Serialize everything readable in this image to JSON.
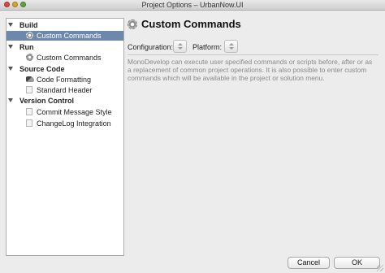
{
  "window": {
    "title": "Project Options – UrbanNow.UI"
  },
  "sidebar": {
    "groups": [
      {
        "label": "Build",
        "items": [
          {
            "label": "Custom Commands",
            "icon": "gear-icon",
            "selected": true
          }
        ]
      },
      {
        "label": "Run",
        "items": [
          {
            "label": "Custom Commands",
            "icon": "gear-icon",
            "selected": false
          }
        ]
      },
      {
        "label": "Source Code",
        "items": [
          {
            "label": "Code Formatting",
            "icon": "brush-icon",
            "selected": false
          },
          {
            "label": "Standard Header",
            "icon": "document-icon",
            "selected": false
          }
        ]
      },
      {
        "label": "Version Control",
        "items": [
          {
            "label": "Commit Message Style",
            "icon": "document-icon",
            "selected": false
          },
          {
            "label": "ChangeLog Integration",
            "icon": "document-icon",
            "selected": false
          }
        ]
      }
    ]
  },
  "main": {
    "title": "Custom Commands",
    "title_icon": "gear-icon",
    "configuration_label": "Configuration:",
    "platform_label": "Platform:",
    "description": "MonoDevelop can execute user specified commands or scripts before, after or as a replacement of common project operations. It is also possible to enter custom commands which will be available in the project or solution menu."
  },
  "buttons": {
    "cancel": "Cancel",
    "ok": "OK"
  },
  "colors": {
    "selection": "#6d88ad",
    "window_bg": "#ececec"
  }
}
